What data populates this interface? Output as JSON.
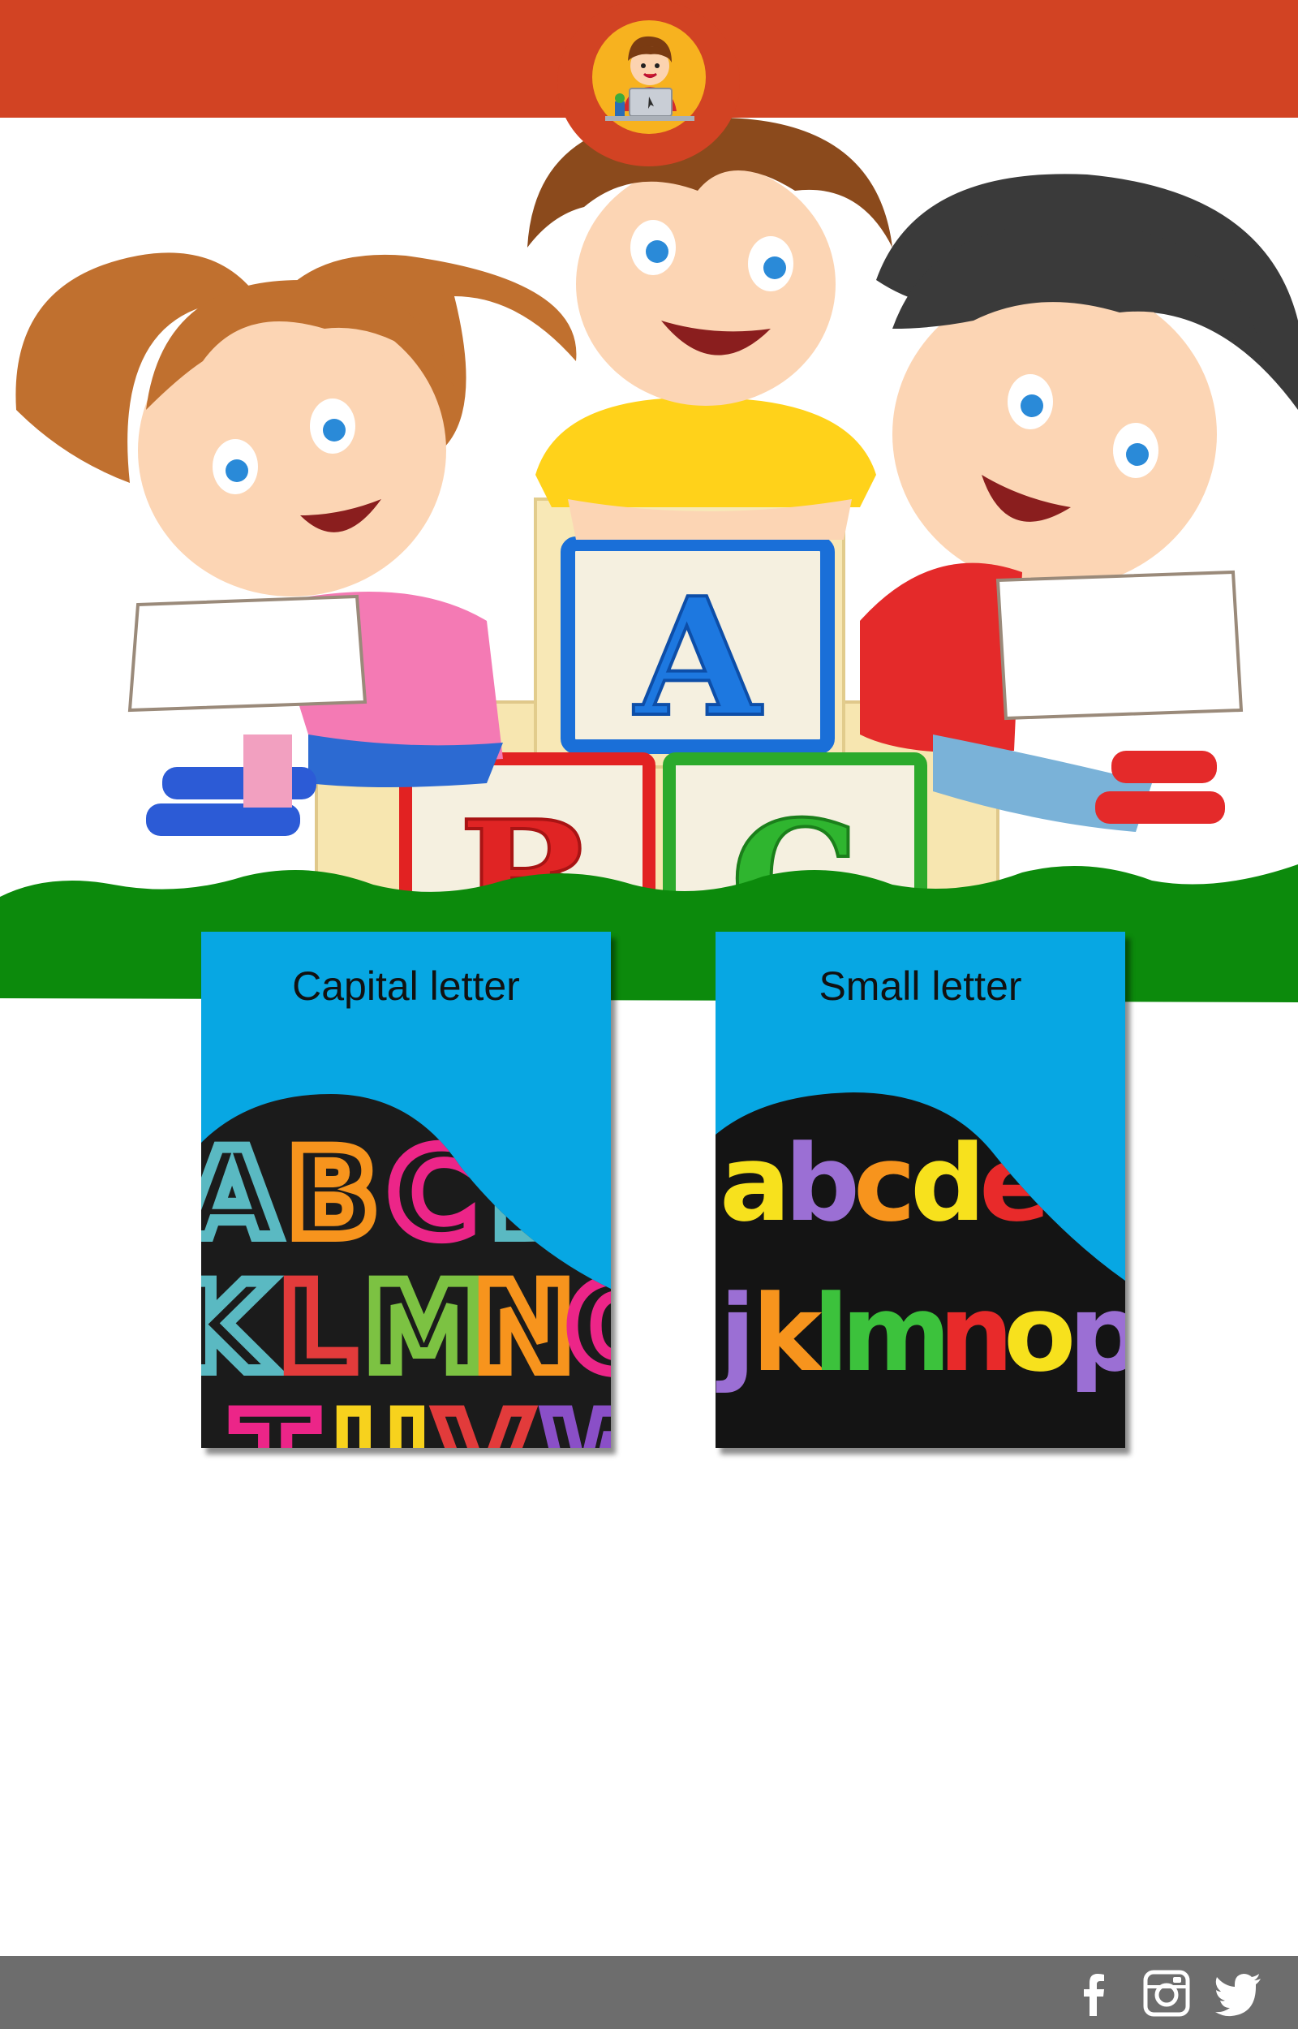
{
  "header": {
    "logo_icon": "kid-with-laptop-icon",
    "colors": {
      "bar": "#d24323",
      "logo_circle": "#f7b21f"
    }
  },
  "hero": {
    "illustration": "three-kids-reading-with-abc-blocks",
    "block_letters": [
      "A",
      "B",
      "C"
    ]
  },
  "cards": [
    {
      "title": "Capital letter",
      "rows": [
        "ABCDE",
        "KLMNO",
        "TUVW"
      ]
    },
    {
      "title": "Small letter",
      "rows": [
        "abcdef",
        "jklmnop"
      ]
    }
  ],
  "footer": {
    "social": [
      {
        "icon": "facebook-icon"
      },
      {
        "icon": "instagram-icon"
      },
      {
        "icon": "twitter-icon"
      }
    ],
    "colors": {
      "bar": "#6d6d6d"
    }
  }
}
